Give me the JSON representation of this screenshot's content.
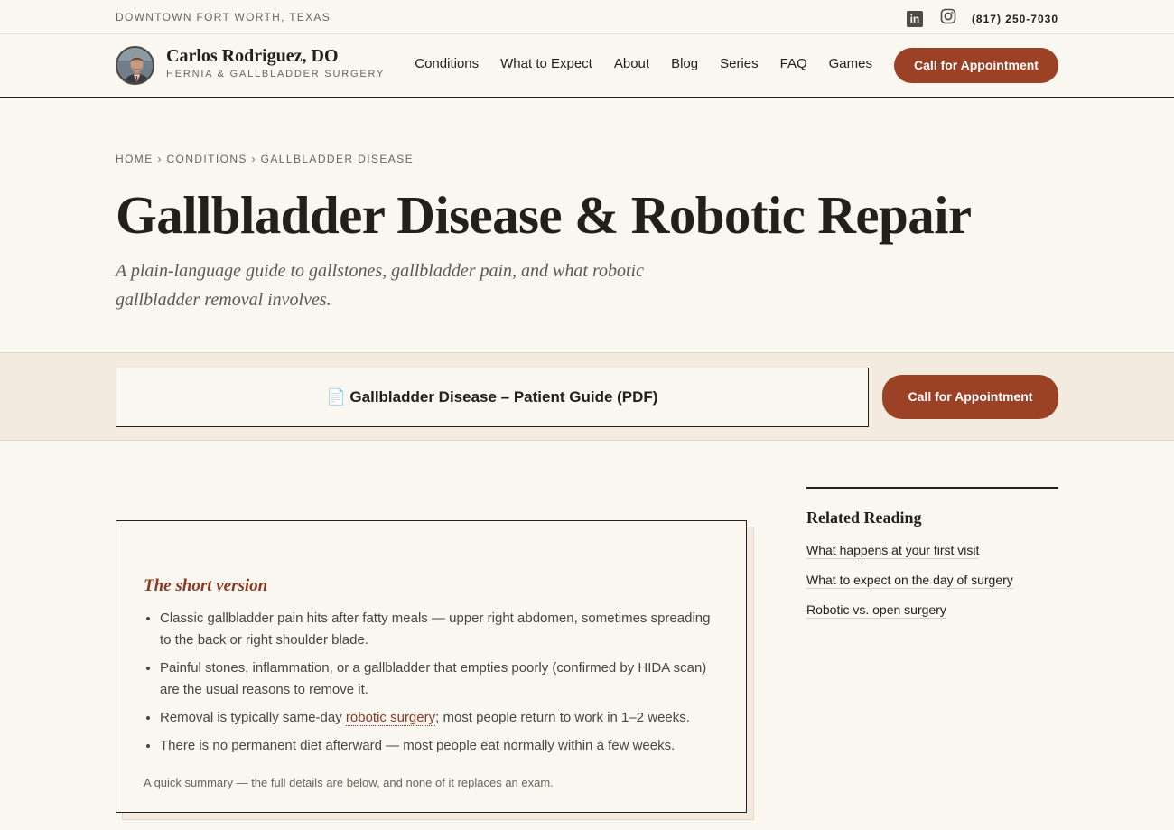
{
  "topbar": {
    "location": "DOWNTOWN FORT WORTH, TEXAS",
    "linkedin_icon": "linkedin-icon",
    "instagram_icon": "instagram-icon",
    "phone": "(817) 250-7030"
  },
  "header": {
    "name": "Carlos Rodriguez, DO",
    "tagline": "HERNIA & GALLBLADDER SURGERY",
    "nav": [
      "Conditions",
      "What to Expect",
      "About",
      "Blog",
      "Series",
      "FAQ",
      "Games"
    ],
    "cta": "Call for Appointment"
  },
  "hero": {
    "breadcrumb": "HOME › CONDITIONS › GALLBLADDER DISEASE",
    "title": "Gallbladder Disease & Robotic Repair",
    "subtitle": "A plain-language guide to gallstones, gallbladder pain, and what robotic gallbladder removal involves."
  },
  "band": {
    "pdf_icon": "📄",
    "pdf_label": "Gallbladder Disease – Patient Guide (PDF)",
    "cta": "Call for Appointment"
  },
  "summary": {
    "heading": "The short version",
    "item1": "Classic gallbladder pain hits after fatty meals — upper right abdomen, sometimes spreading to the back or right shoulder blade.",
    "item2": "Painful stones, inflammation, or a gallbladder that empties poorly (confirmed by HIDA scan) are the usual reasons to remove it.",
    "item3_before": "Removal is typically same-day ",
    "item3_link": "robotic surgery",
    "item3_after": "; most people return to work in 1–2 weeks.",
    "item4": "There is no permanent diet afterward — most people eat normally within a few weeks.",
    "note": "A quick summary — the full details are below, and none of it replaces an exam."
  },
  "sidebar": {
    "title": "Related Reading",
    "links": [
      "What happens at your first visit",
      "What to expect on the day of surgery",
      "Robotic vs. open surgery"
    ]
  },
  "colors": {
    "accent": "#9a4126",
    "background": "#faf6f0",
    "band": "#f3ebe0",
    "text": "#23201b"
  }
}
